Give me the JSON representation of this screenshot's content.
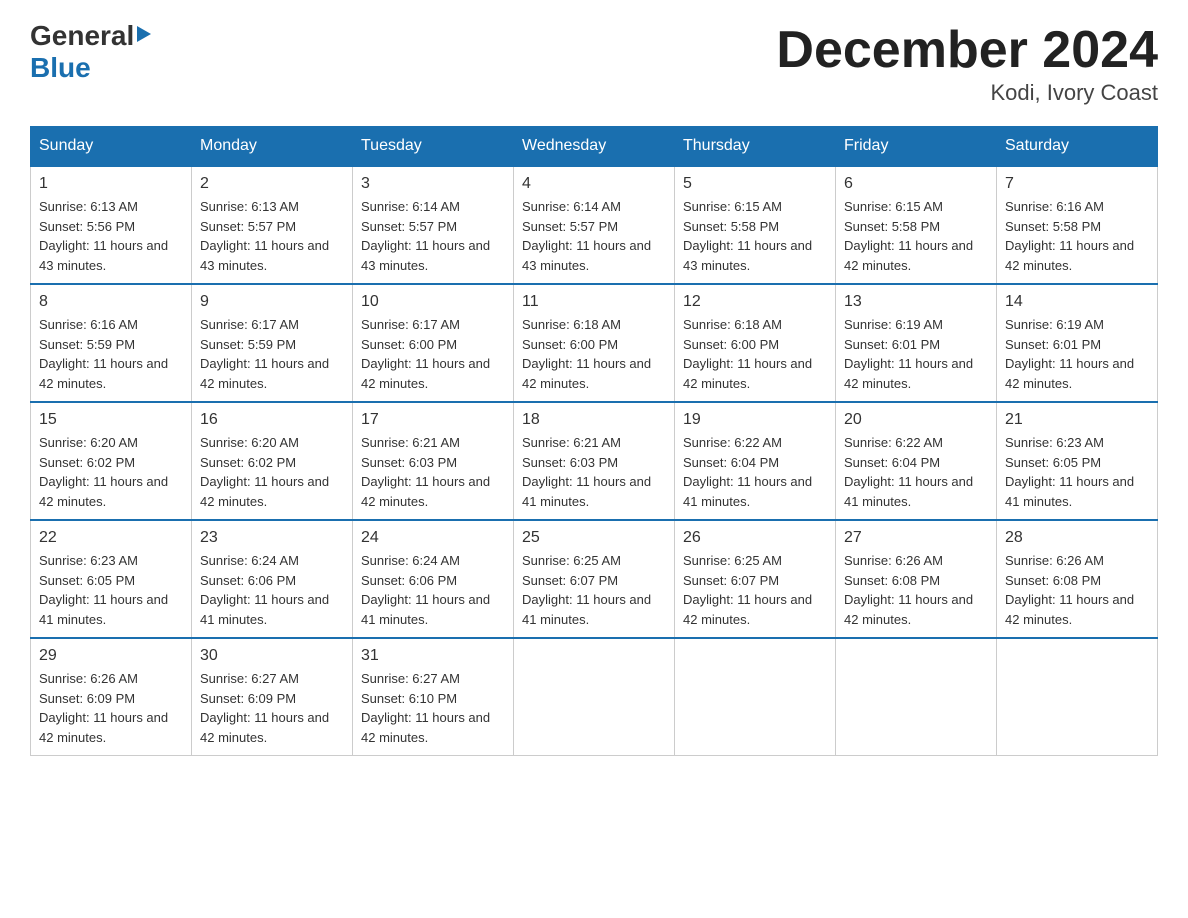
{
  "header": {
    "logo_general": "General",
    "logo_blue": "Blue",
    "title": "December 2024",
    "subtitle": "Kodi, Ivory Coast"
  },
  "calendar": {
    "days_of_week": [
      "Sunday",
      "Monday",
      "Tuesday",
      "Wednesday",
      "Thursday",
      "Friday",
      "Saturday"
    ],
    "weeks": [
      [
        {
          "day": "1",
          "sunrise": "6:13 AM",
          "sunset": "5:56 PM",
          "daylight": "11 hours and 43 minutes."
        },
        {
          "day": "2",
          "sunrise": "6:13 AM",
          "sunset": "5:57 PM",
          "daylight": "11 hours and 43 minutes."
        },
        {
          "day": "3",
          "sunrise": "6:14 AM",
          "sunset": "5:57 PM",
          "daylight": "11 hours and 43 minutes."
        },
        {
          "day": "4",
          "sunrise": "6:14 AM",
          "sunset": "5:57 PM",
          "daylight": "11 hours and 43 minutes."
        },
        {
          "day": "5",
          "sunrise": "6:15 AM",
          "sunset": "5:58 PM",
          "daylight": "11 hours and 43 minutes."
        },
        {
          "day": "6",
          "sunrise": "6:15 AM",
          "sunset": "5:58 PM",
          "daylight": "11 hours and 42 minutes."
        },
        {
          "day": "7",
          "sunrise": "6:16 AM",
          "sunset": "5:58 PM",
          "daylight": "11 hours and 42 minutes."
        }
      ],
      [
        {
          "day": "8",
          "sunrise": "6:16 AM",
          "sunset": "5:59 PM",
          "daylight": "11 hours and 42 minutes."
        },
        {
          "day": "9",
          "sunrise": "6:17 AM",
          "sunset": "5:59 PM",
          "daylight": "11 hours and 42 minutes."
        },
        {
          "day": "10",
          "sunrise": "6:17 AM",
          "sunset": "6:00 PM",
          "daylight": "11 hours and 42 minutes."
        },
        {
          "day": "11",
          "sunrise": "6:18 AM",
          "sunset": "6:00 PM",
          "daylight": "11 hours and 42 minutes."
        },
        {
          "day": "12",
          "sunrise": "6:18 AM",
          "sunset": "6:00 PM",
          "daylight": "11 hours and 42 minutes."
        },
        {
          "day": "13",
          "sunrise": "6:19 AM",
          "sunset": "6:01 PM",
          "daylight": "11 hours and 42 minutes."
        },
        {
          "day": "14",
          "sunrise": "6:19 AM",
          "sunset": "6:01 PM",
          "daylight": "11 hours and 42 minutes."
        }
      ],
      [
        {
          "day": "15",
          "sunrise": "6:20 AM",
          "sunset": "6:02 PM",
          "daylight": "11 hours and 42 minutes."
        },
        {
          "day": "16",
          "sunrise": "6:20 AM",
          "sunset": "6:02 PM",
          "daylight": "11 hours and 42 minutes."
        },
        {
          "day": "17",
          "sunrise": "6:21 AM",
          "sunset": "6:03 PM",
          "daylight": "11 hours and 42 minutes."
        },
        {
          "day": "18",
          "sunrise": "6:21 AM",
          "sunset": "6:03 PM",
          "daylight": "11 hours and 41 minutes."
        },
        {
          "day": "19",
          "sunrise": "6:22 AM",
          "sunset": "6:04 PM",
          "daylight": "11 hours and 41 minutes."
        },
        {
          "day": "20",
          "sunrise": "6:22 AM",
          "sunset": "6:04 PM",
          "daylight": "11 hours and 41 minutes."
        },
        {
          "day": "21",
          "sunrise": "6:23 AM",
          "sunset": "6:05 PM",
          "daylight": "11 hours and 41 minutes."
        }
      ],
      [
        {
          "day": "22",
          "sunrise": "6:23 AM",
          "sunset": "6:05 PM",
          "daylight": "11 hours and 41 minutes."
        },
        {
          "day": "23",
          "sunrise": "6:24 AM",
          "sunset": "6:06 PM",
          "daylight": "11 hours and 41 minutes."
        },
        {
          "day": "24",
          "sunrise": "6:24 AM",
          "sunset": "6:06 PM",
          "daylight": "11 hours and 41 minutes."
        },
        {
          "day": "25",
          "sunrise": "6:25 AM",
          "sunset": "6:07 PM",
          "daylight": "11 hours and 41 minutes."
        },
        {
          "day": "26",
          "sunrise": "6:25 AM",
          "sunset": "6:07 PM",
          "daylight": "11 hours and 42 minutes."
        },
        {
          "day": "27",
          "sunrise": "6:26 AM",
          "sunset": "6:08 PM",
          "daylight": "11 hours and 42 minutes."
        },
        {
          "day": "28",
          "sunrise": "6:26 AM",
          "sunset": "6:08 PM",
          "daylight": "11 hours and 42 minutes."
        }
      ],
      [
        {
          "day": "29",
          "sunrise": "6:26 AM",
          "sunset": "6:09 PM",
          "daylight": "11 hours and 42 minutes."
        },
        {
          "day": "30",
          "sunrise": "6:27 AM",
          "sunset": "6:09 PM",
          "daylight": "11 hours and 42 minutes."
        },
        {
          "day": "31",
          "sunrise": "6:27 AM",
          "sunset": "6:10 PM",
          "daylight": "11 hours and 42 minutes."
        },
        null,
        null,
        null,
        null
      ]
    ]
  }
}
